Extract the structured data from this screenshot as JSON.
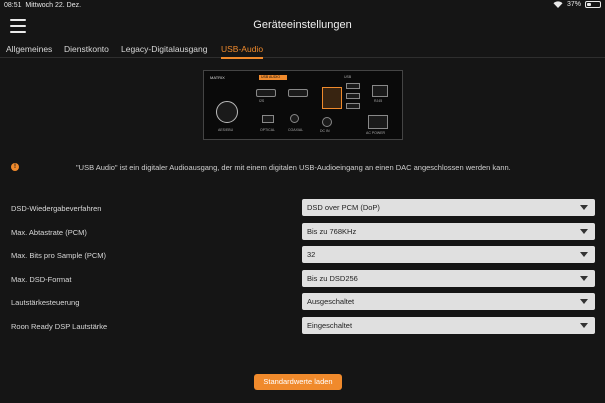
{
  "status": {
    "time": "08:51",
    "date": "Mittwoch 22. Dez.",
    "battery": "37%",
    "battery_level": 0.37
  },
  "header": {
    "title": "Geräteeinstellungen"
  },
  "tabs": [
    {
      "label": "Allgemeines",
      "active": false
    },
    {
      "label": "Dienstkonto",
      "active": false
    },
    {
      "label": "Legacy-Digitalausgang",
      "active": false
    },
    {
      "label": "USB-Audio",
      "active": true
    }
  ],
  "device": {
    "brand": "MATRIX",
    "highlight": "USB AUDIO",
    "ports": [
      "AES/EBU",
      "COAXIAL",
      "OPTICAL",
      "AC POWER",
      "DC IN",
      "I2S",
      "RJ45",
      "USB"
    ]
  },
  "info": {
    "icon": "info-icon",
    "text": "\"USB Audio\" ist ein digitaler Audioausgang, der mit einem digitalen USB-Audioeingang an einen DAC angeschlossen werden kann."
  },
  "settings": [
    {
      "label": "DSD-Wiedergabeverfahren",
      "value": "DSD over PCM (DoP)"
    },
    {
      "label": "Max. Abtastrate (PCM)",
      "value": "Bis zu 768KHz"
    },
    {
      "label": "Max. Bits pro Sample (PCM)",
      "value": "32"
    },
    {
      "label": "Max. DSD-Format",
      "value": "Bis zu DSD256"
    },
    {
      "label": "Lautstärkesteuerung",
      "value": "Ausgeschaltet"
    },
    {
      "label": "Roon Ready DSP Lautstärke",
      "value": "Eingeschaltet"
    }
  ],
  "actions": {
    "reset_label": "Standardwerte laden"
  },
  "colors": {
    "accent": "#f08a2c",
    "background": "#151515",
    "select_bg": "#e0e0e0"
  }
}
